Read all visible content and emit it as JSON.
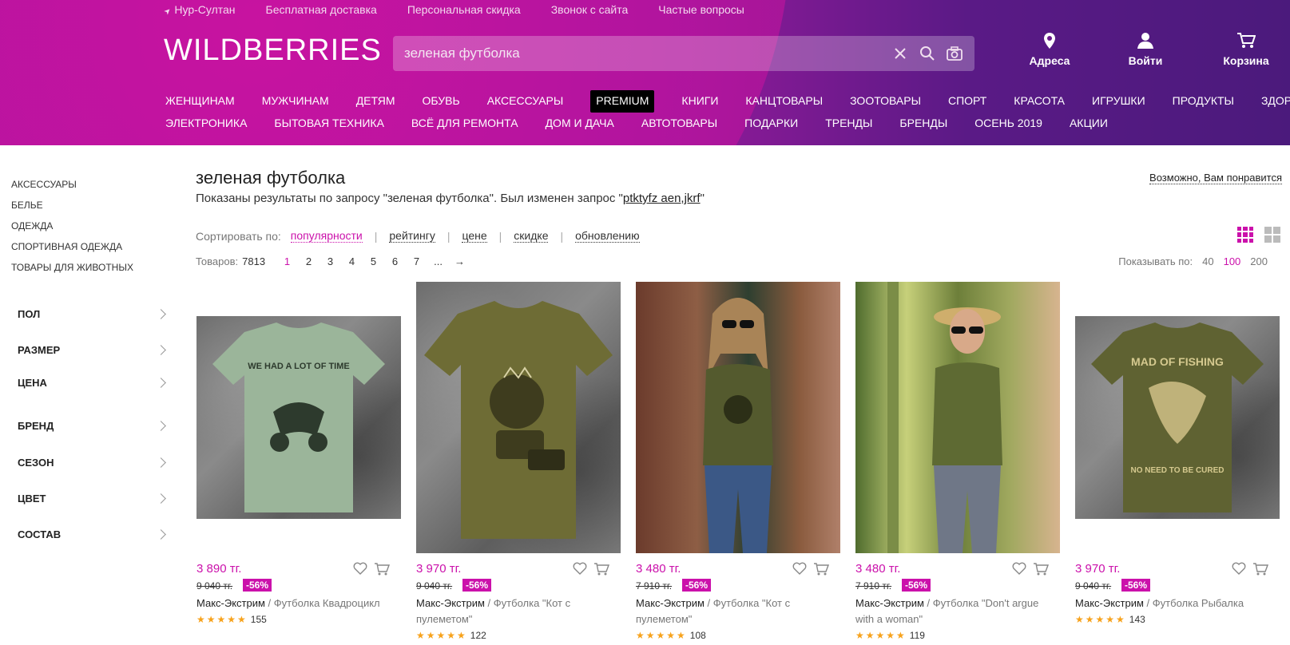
{
  "header": {
    "location": "Нур-Султан",
    "top_links": [
      "Бесплатная доставка",
      "Персональная скидка",
      "Звонок с сайта",
      "Частые вопросы"
    ],
    "logo": "WILDBERRIES",
    "search_value": "зеленая футболка",
    "address_label": "Адреса",
    "login_label": "Войти",
    "cart_label": "Корзина",
    "menu_row1": [
      "ЖЕНЩИНАМ",
      "МУЖЧИНАМ",
      "ДЕТЯМ",
      "ОБУВЬ",
      "АКСЕССУАРЫ",
      "PREMIUM",
      "КНИГИ",
      "КАНЦТОВАРЫ",
      "ЗООТОВАРЫ",
      "СПОРТ",
      "КРАСОТА",
      "ИГРУШКИ",
      "ПРОДУКТЫ",
      "ЗДОРОВЬЕ"
    ],
    "menu_row2": [
      "ЭЛЕКТРОНИКА",
      "БЫТОВАЯ ТЕХНИКА",
      "ВСЁ ДЛЯ РЕМОНТА",
      "ДОМ И ДАЧА",
      "АВТОТОВАРЫ",
      "ПОДАРКИ",
      "ТРЕНДЫ",
      "БРЕНДЫ",
      "ОСЕНЬ 2019",
      "АКЦИИ"
    ]
  },
  "sidebar": {
    "categories": [
      "АКСЕССУАРЫ",
      "БЕЛЬЕ",
      "ОДЕЖДА",
      "СПОРТИВНАЯ ОДЕЖДА",
      "ТОВАРЫ ДЛЯ ЖИВОТНЫХ"
    ],
    "filters": [
      "ПОЛ",
      "РАЗМЕР",
      "ЦЕНА",
      "БРЕНД",
      "СЕЗОН",
      "ЦВЕТ",
      "СОСТАВ"
    ]
  },
  "main": {
    "title": "зеленая футболка",
    "notice_prefix": "Показаны результаты по запросу \"зеленая футболка\". Был изменен запрос \"",
    "notice_query": "ptktyfz aen,jkrf",
    "notice_suffix": "\"",
    "maybe_like": "Возможно, Вам понравится",
    "sort_label": "Сортировать по:",
    "sort_options": [
      "популярности",
      "рейтингу",
      "цене",
      "скидке",
      "обновлению"
    ],
    "count_label": "Товаров:",
    "count_value": "7813",
    "pages": [
      "1",
      "2",
      "3",
      "4",
      "5",
      "6",
      "7",
      "...",
      "→"
    ],
    "perpage_label": "Показывать по:",
    "perpage_options": [
      "40",
      "100",
      "200"
    ]
  },
  "products": [
    {
      "price": "3 890 тг.",
      "old_price": "9 040 тг.",
      "discount": "-56%",
      "brand": "Макс-Экстрим",
      "name": "Футболка Квадроцикл",
      "reviews": "155",
      "print": "WE HAD A LOT OF TIME"
    },
    {
      "price": "3 970 тг.",
      "old_price": "9 040 тг.",
      "discount": "-56%",
      "brand": "Макс-Экстрим",
      "name": "Футболка \"Кот с пулеметом\"",
      "reviews": "122"
    },
    {
      "price": "3 480 тг.",
      "old_price": "7 910 тг.",
      "discount": "-56%",
      "brand": "Макс-Экстрим",
      "name": "Футболка \"Кот с пулеметом\"",
      "reviews": "108"
    },
    {
      "price": "3 480 тг.",
      "old_price": "7 910 тг.",
      "discount": "-56%",
      "brand": "Макс-Экстрим",
      "name": "Футболка \"Don't argue with a woman\"",
      "reviews": "119"
    },
    {
      "price": "3 970 тг.",
      "old_price": "9 040 тг.",
      "discount": "-56%",
      "brand": "Макс-Экстрим",
      "name": "Футболка Рыбалка",
      "reviews": "143",
      "print_top": "MAD OF FISHING",
      "print_bottom": "NO NEED TO BE CURED"
    }
  ],
  "colors": {
    "accent": "#cb11ab",
    "star": "#f7a21b"
  }
}
